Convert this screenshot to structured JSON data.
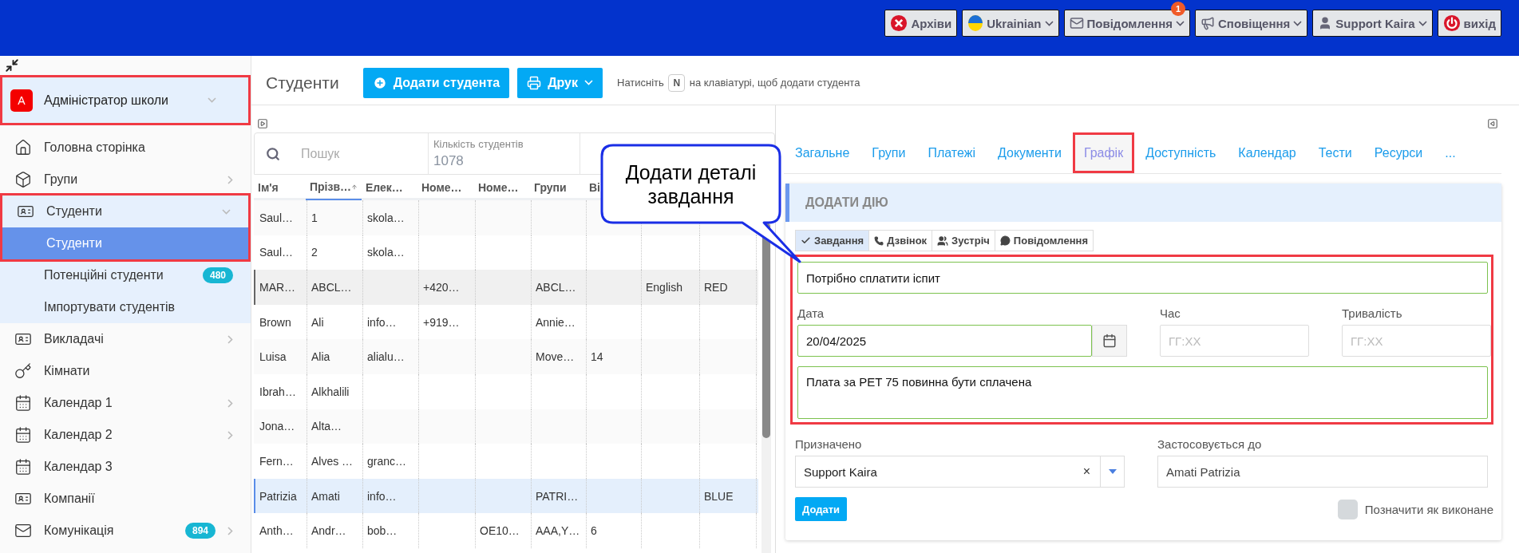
{
  "top_bar": {
    "buttons": [
      {
        "kind": "archive",
        "label": "Архіви",
        "dropdown": false
      },
      {
        "kind": "language",
        "label": "Ukrainian",
        "dropdown": true
      },
      {
        "kind": "messages",
        "label": "Повідомлення",
        "dropdown": true,
        "badge": "1"
      },
      {
        "kind": "notifications",
        "label": "Сповіщення",
        "dropdown": true
      },
      {
        "kind": "user",
        "label": "Support Kaira",
        "dropdown": true
      },
      {
        "kind": "logout",
        "label": "вихід",
        "dropdown": false
      }
    ]
  },
  "sidebar": {
    "header": {
      "avatar": "A",
      "label": "Адміністратор школи",
      "highlighted": true
    },
    "items": [
      {
        "label": "Головна сторінка",
        "expandable": false,
        "expanded": false,
        "highlighted": false
      },
      {
        "label": "Групи",
        "expandable": true,
        "expanded": false,
        "highlighted": false
      },
      {
        "label": "Студенти",
        "expandable": true,
        "expanded": true,
        "highlighted": true,
        "children": [
          {
            "label": "Студенти",
            "selected": true
          },
          {
            "label": "Потенційні студенти",
            "selected": false,
            "badge": "480"
          },
          {
            "label": "Імпортувати студентів",
            "selected": false
          }
        ]
      },
      {
        "label": "Викладачі",
        "expandable": true,
        "expanded": false,
        "highlighted": false
      },
      {
        "label": "Кімнати",
        "expandable": false,
        "expanded": false,
        "highlighted": false
      },
      {
        "label": "Календар 1",
        "expandable": true,
        "expanded": false,
        "highlighted": false
      },
      {
        "label": "Календар 2",
        "expandable": true,
        "expanded": false,
        "highlighted": false
      },
      {
        "label": "Календар 3",
        "expandable": false,
        "expanded": false,
        "highlighted": false
      },
      {
        "label": "Компанії",
        "expandable": false,
        "expanded": false,
        "highlighted": false
      },
      {
        "label": "Комунікація",
        "expandable": true,
        "expanded": false,
        "highlighted": false,
        "badge": "894"
      }
    ]
  },
  "page": {
    "title": "Студенти",
    "add_button": "Додати студента",
    "print_button": "Друк",
    "hint": {
      "before": "Натисніть",
      "key": "N",
      "after": "на клавіатурі, щоб додати студента"
    }
  },
  "table": {
    "search": {
      "placeholder": "Пошук"
    },
    "count_label": "Кількість студентів",
    "count": "1078",
    "columns": [
      {
        "label": "Ім'я",
        "sorted": false
      },
      {
        "label": "Прізв…",
        "sorted": true
      },
      {
        "label": "Елек…",
        "sorted": false
      },
      {
        "label": "Номе…",
        "sorted": false
      },
      {
        "label": "Номе…",
        "sorted": false
      },
      {
        "label": "Групи",
        "sorted": false
      },
      {
        "label": "Ві",
        "sorted": false
      }
    ],
    "rows": [
      {
        "cells": [
          "Saul…",
          "1",
          "skola…",
          "",
          "",
          "",
          "",
          "",
          ""
        ],
        "selected": false,
        "hovered": false
      },
      {
        "cells": [
          "Saul…",
          "2",
          "skola…",
          "",
          "",
          "",
          "",
          "",
          ""
        ],
        "selected": false,
        "hovered": false
      },
      {
        "cells": [
          "MAR…",
          "ABCL…",
          "",
          "+420…",
          "",
          "ABCL…",
          "",
          "English",
          "RED"
        ],
        "selected": false,
        "hovered": true
      },
      {
        "cells": [
          "Brown",
          "Ali",
          "info…",
          "+919…",
          "",
          "Annie…",
          "",
          "",
          ""
        ],
        "selected": false,
        "hovered": false
      },
      {
        "cells": [
          "Luisa",
          "Alia",
          "alialu…",
          "",
          "",
          "Move…",
          "14",
          "",
          ""
        ],
        "selected": false,
        "hovered": false
      },
      {
        "cells": [
          "Ibrah…",
          "Alkhalili",
          "",
          "",
          "",
          "",
          "",
          "",
          ""
        ],
        "selected": false,
        "hovered": false
      },
      {
        "cells": [
          "Jona…",
          "Alta…",
          "",
          "",
          "",
          "",
          "",
          "",
          ""
        ],
        "selected": false,
        "hovered": false
      },
      {
        "cells": [
          "Fern…",
          "Alves …",
          "granc…",
          "",
          "",
          "",
          "",
          "",
          ""
        ],
        "selected": false,
        "hovered": false
      },
      {
        "cells": [
          "Patrizia",
          "Amati",
          "info…",
          "",
          "",
          "PATRI…",
          "",
          "",
          "BLUE"
        ],
        "selected": true,
        "hovered": false
      },
      {
        "cells": [
          "Anth…",
          "Andr…",
          "bob…",
          "",
          "OE10…",
          "AAA,Y…",
          "6",
          "",
          ""
        ],
        "selected": false,
        "hovered": false
      }
    ]
  },
  "callout": {
    "text": "Додати деталі завдання"
  },
  "detail": {
    "tabs": [
      {
        "label": "Загальне",
        "selected": false,
        "highlighted": false
      },
      {
        "label": "Групи",
        "selected": false,
        "highlighted": false
      },
      {
        "label": "Платежі",
        "selected": false,
        "highlighted": false
      },
      {
        "label": "Документи",
        "selected": false,
        "highlighted": false
      },
      {
        "label": "Графік",
        "selected": true,
        "highlighted": true
      },
      {
        "label": "Доступність",
        "selected": false,
        "highlighted": false
      },
      {
        "label": "Календар",
        "selected": false,
        "highlighted": false
      },
      {
        "label": "Тести",
        "selected": false,
        "highlighted": false
      },
      {
        "label": "Ресурси",
        "selected": false,
        "highlighted": false
      },
      {
        "label": "...",
        "selected": false,
        "highlighted": false
      }
    ],
    "card": {
      "title": "ДОДАТИ ДІЮ",
      "action_types": [
        {
          "kind": "task",
          "label": "Завдання",
          "selected": true
        },
        {
          "kind": "call",
          "label": "Дзвінок",
          "selected": false
        },
        {
          "kind": "meeting",
          "label": "Зустріч",
          "selected": false
        },
        {
          "kind": "message",
          "label": "Повідомлення",
          "selected": false
        }
      ],
      "form": {
        "highlighted": true,
        "title": {
          "value": "Потрібно сплатити іспит"
        },
        "date": {
          "label": "Дата",
          "value": "20/04/2025"
        },
        "time": {
          "label": "Час",
          "placeholder": "ГГ:ХХ"
        },
        "duration": {
          "label": "Тривалість",
          "placeholder": "ГГ:ХХ"
        },
        "description": {
          "value": "Плата за PET 75 повинна бути сплачена"
        }
      },
      "assigned": {
        "label": "Призначено",
        "value": "Support Kaira",
        "clear": "×"
      },
      "applies_to": {
        "label": "Застосовується до",
        "value": "Amati Patrizia"
      },
      "submit": "Додати",
      "done": {
        "label": "Позначити як виконане",
        "checked": false
      }
    }
  }
}
